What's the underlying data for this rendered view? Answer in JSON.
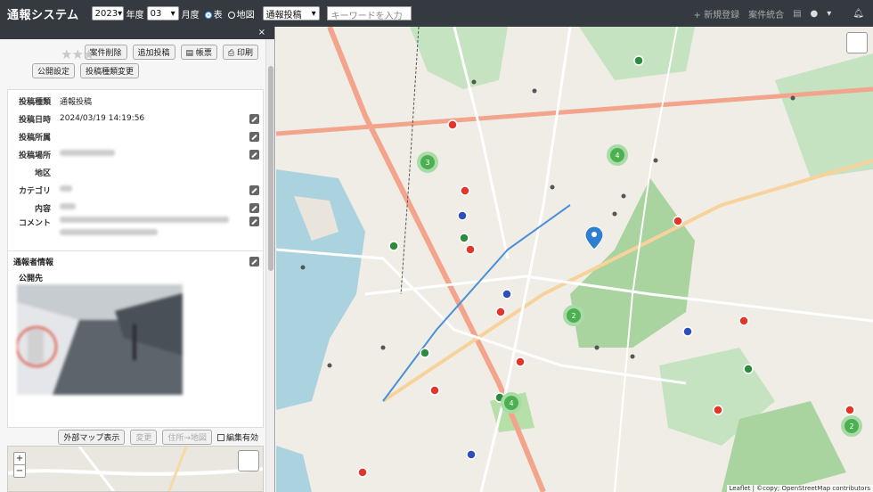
{
  "topbar": {
    "title": "通報システム",
    "year": "2023",
    "year_label": "年度",
    "month": "03",
    "month_label": "月度",
    "view_table": "表",
    "view_map": "地図",
    "post_type": "通報投稿",
    "keyword_placeholder": "キーワードを入力",
    "new_label": "+ 新規登録",
    "merge_label": "案件統合"
  },
  "panel": {
    "close": "×",
    "buttons": [
      "案件削除",
      "追加投稿",
      "帳票",
      "印刷"
    ],
    "buttons2": [
      "公開設定",
      "投稿種類変更"
    ],
    "fields": [
      {
        "label": "投稿種類",
        "value": "通報投稿",
        "editable": false
      },
      {
        "label": "投稿日時",
        "value": "2024/03/19 14:19:56",
        "editable": true
      },
      {
        "label": "投稿所属",
        "value": "",
        "editable": true
      },
      {
        "label": "投稿場所",
        "value": "",
        "editable": true
      },
      {
        "label": "地区",
        "value": "",
        "editable": false
      },
      {
        "label": "カテゴリ",
        "value": "",
        "editable": true
      },
      {
        "label": "内容",
        "value": "",
        "editable": true
      },
      {
        "label": "コメント",
        "value": "",
        "editable": true
      }
    ],
    "reporter_label": "通報者情報",
    "public_label": "公開先",
    "map_controls": [
      "外部マップ表示",
      "変更",
      "住所→地図"
    ],
    "edit_checkbox": "編集有効"
  },
  "map": {
    "clusters": [
      "3",
      "4",
      "2",
      "4",
      "2"
    ],
    "attribution": "Leaflet | ©copy; OpenStreetMap contributors"
  }
}
